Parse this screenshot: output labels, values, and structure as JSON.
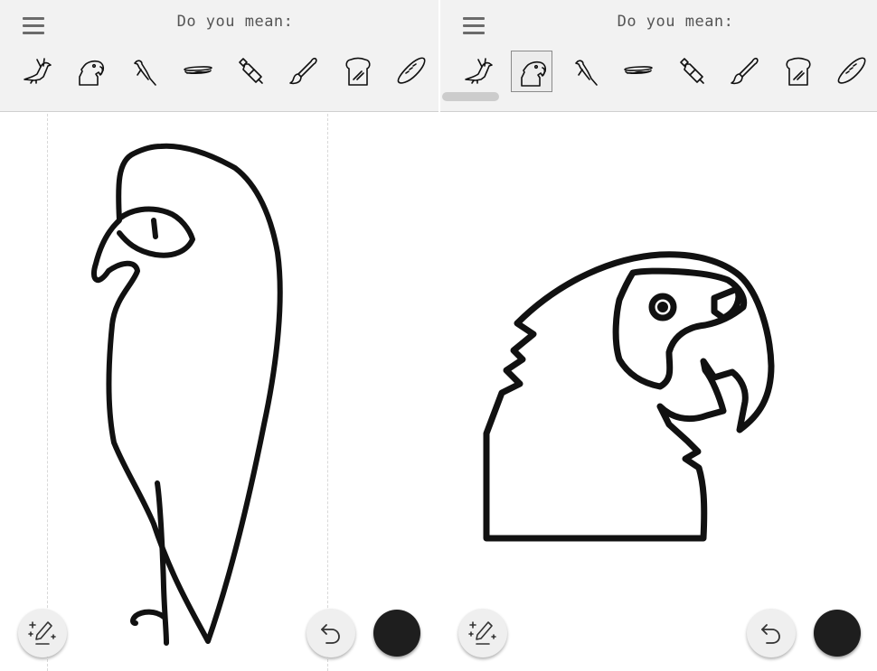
{
  "colors": {
    "header_bg": "#f2f2f2",
    "canvas_bg": "#ffffff",
    "ink": "#111111",
    "icon_gray": "#6b6b6b",
    "selected_color": "#1e1e1e"
  },
  "panels": [
    {
      "prompt": "Do you mean:",
      "suggestions": [
        "bird-icon",
        "parrot-head-icon",
        "parrot-perched-icon",
        "hotdog-icon",
        "paint-tube-icon",
        "paintbrush-icon",
        "bread-slice-icon",
        "baguette-icon"
      ],
      "selected_suggestion": null,
      "drawing": "hand-drawn-bird-sketch",
      "selected_pen_color": "#1e1e1e"
    },
    {
      "prompt": "Do you mean:",
      "suggestions": [
        "bird-icon",
        "parrot-head-icon",
        "parrot-perched-icon",
        "hotdog-icon",
        "paint-tube-icon",
        "paintbrush-icon",
        "bread-slice-icon",
        "baguette-icon"
      ],
      "selected_suggestion": "parrot-head-icon",
      "drawing": "parrot-head-drawing",
      "selected_pen_color": "#1e1e1e"
    }
  ]
}
